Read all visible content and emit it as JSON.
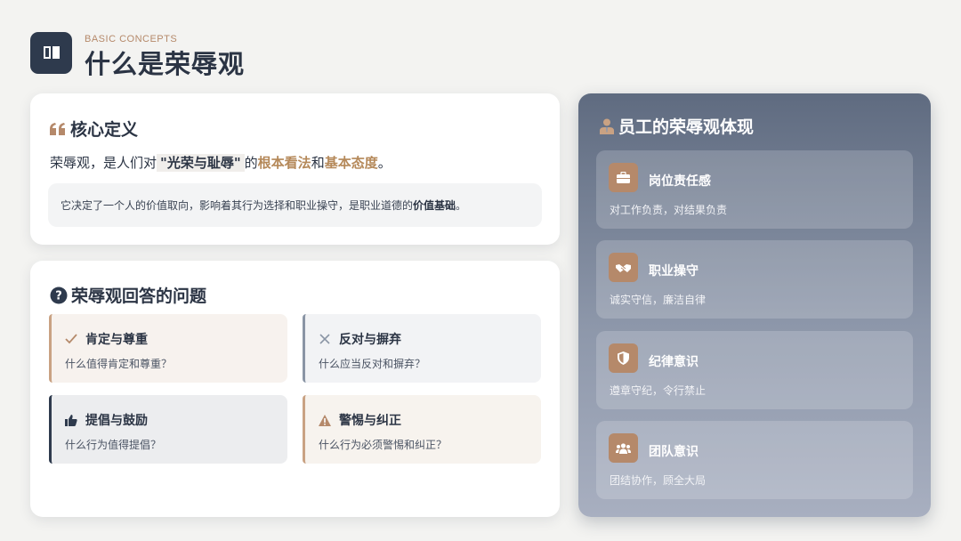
{
  "header": {
    "subtitle": "BASIC CONCEPTS",
    "title": "什么是荣辱观",
    "icon": "book-icon"
  },
  "definition": {
    "title": "核心定义",
    "icon": "quote-icon",
    "sentence_prefix": "荣辱观，是人们对",
    "sentence_quote": "\"光荣与耻辱\"",
    "sentence_mid1": "的",
    "sentence_key1": "根本看法",
    "sentence_and": "和",
    "sentence_key2": "基本态度",
    "sentence_end": "。",
    "note_text": "它决定了一个人的价值取向，影响着其行为选择和职业操守，是职业道德的",
    "note_bold": "价值基础",
    "note_end": "。"
  },
  "questions": {
    "title": "荣辱观回答的问题",
    "icon": "question-circle-icon",
    "items": [
      {
        "label": "肯定与尊重",
        "desc": "什么值得肯定和尊重？",
        "icon": "check-icon"
      },
      {
        "label": "反对与摒弃",
        "desc": "什么应当反对和摒弃？",
        "icon": "cross-icon"
      },
      {
        "label": "提倡与鼓励",
        "desc": "什么行为值得提倡？",
        "icon": "thumbs-up-icon"
      },
      {
        "label": "警惕与纠正",
        "desc": "什么行为必须警惕和纠正？",
        "icon": "warning-icon"
      }
    ]
  },
  "panel": {
    "title": "员工的荣辱观体现",
    "icon": "person-icon",
    "items": [
      {
        "title": "岗位责任感",
        "desc": "对工作负责，对结果负责",
        "icon": "briefcase-icon"
      },
      {
        "title": "职业操守",
        "desc": "诚实守信，廉洁自律",
        "icon": "handshake-icon"
      },
      {
        "title": "纪律意识",
        "desc": "遵章守纪，令行禁止",
        "icon": "shield-icon"
      },
      {
        "title": "团队意识",
        "desc": "团结协作，顾全大局",
        "icon": "team-icon"
      }
    ]
  },
  "colors": {
    "accent": "#b5896a",
    "navy": "#2e3a4d",
    "background": "#f3f3f1"
  }
}
